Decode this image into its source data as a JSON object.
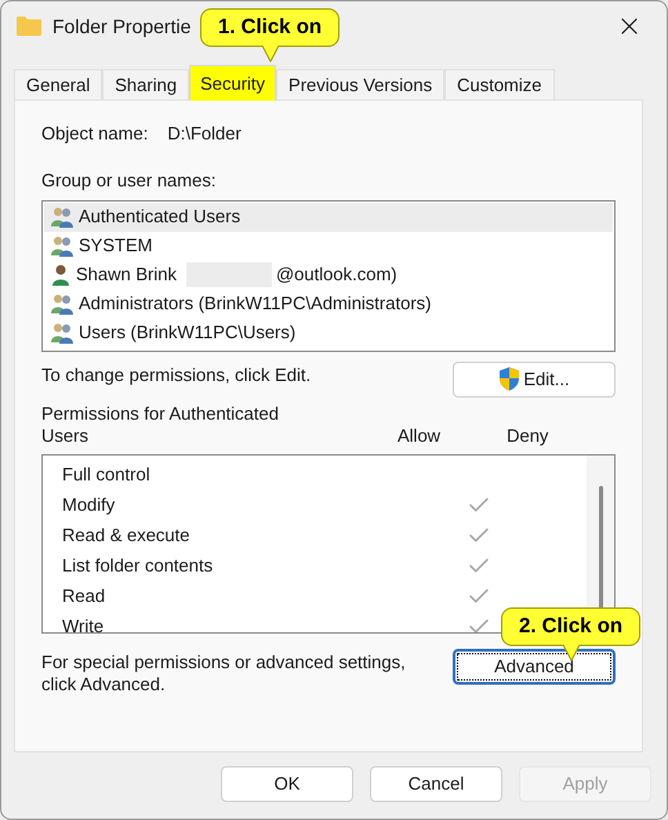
{
  "window": {
    "title": "Folder Propertie"
  },
  "callouts": [
    {
      "text": "1. Click on"
    },
    {
      "text": "2. Click on"
    }
  ],
  "tabs": [
    {
      "label": "General",
      "selected": false
    },
    {
      "label": "Sharing",
      "selected": false
    },
    {
      "label": "Security",
      "selected": true
    },
    {
      "label": "Previous Versions",
      "selected": false
    },
    {
      "label": "Customize",
      "selected": false
    }
  ],
  "object_name": {
    "label": "Object name:",
    "value": "D:\\Folder"
  },
  "groups": {
    "label": "Group or user names:",
    "items": [
      {
        "kind": "group",
        "name": "Authenticated Users",
        "selected": true
      },
      {
        "kind": "group",
        "name": "SYSTEM",
        "selected": false
      },
      {
        "kind": "user",
        "name": "Shawn Brink",
        "redacted": true,
        "suffix": "@outlook.com)",
        "selected": false
      },
      {
        "kind": "group",
        "name": "Administrators (BrinkW11PC\\Administrators)",
        "selected": false
      },
      {
        "kind": "group",
        "name": "Users (BrinkW11PC\\Users)",
        "selected": false
      }
    ]
  },
  "edit_hint": "To change permissions, click Edit.",
  "edit_button": "Edit...",
  "permissions": {
    "label": "Permissions for Authenticated Users",
    "allow_header": "Allow",
    "deny_header": "Deny",
    "items": [
      {
        "name": "Full control",
        "allow": false
      },
      {
        "name": "Modify",
        "allow": true
      },
      {
        "name": "Read & execute",
        "allow": true
      },
      {
        "name": "List folder contents",
        "allow": true
      },
      {
        "name": "Read",
        "allow": true
      },
      {
        "name": "Write",
        "allow": true
      }
    ]
  },
  "advanced_hint": "For special permissions or advanced settings, click Advanced.",
  "advanced_button": {
    "label": "Advanced",
    "focused": true
  },
  "buttons": [
    {
      "label": "OK",
      "disabled": false
    },
    {
      "label": "Cancel",
      "disabled": false
    },
    {
      "label": "Apply",
      "disabled": true
    }
  ]
}
